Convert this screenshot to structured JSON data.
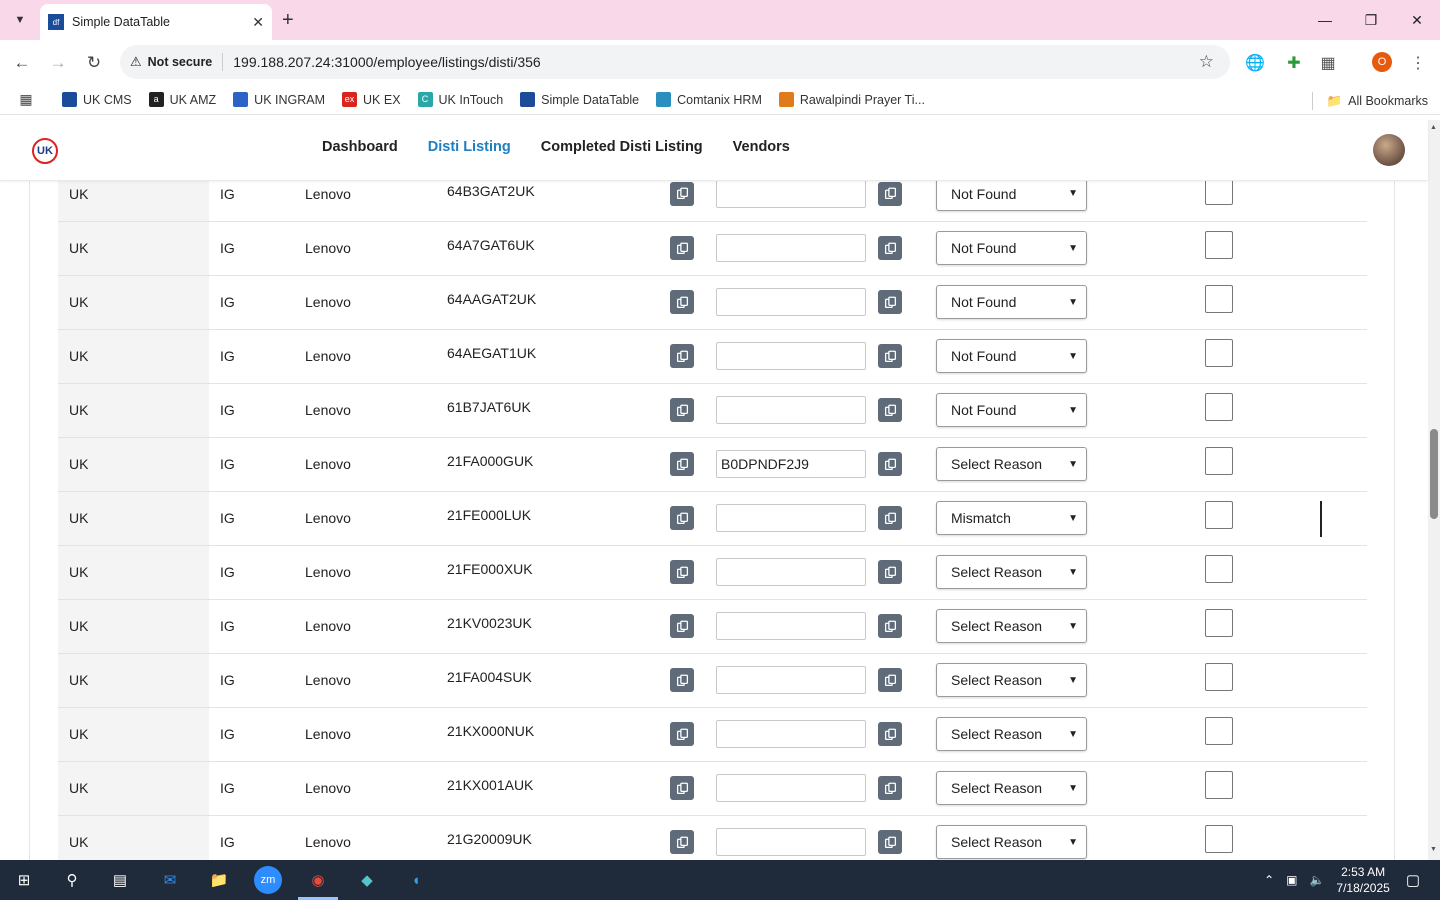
{
  "browser": {
    "tab_title": "Simple DataTable",
    "tab_favicon": "df",
    "new_tab": "+",
    "security_label": "Not secure",
    "url": "199.188.207.24:31000/employee/listings/disti/356",
    "profile_initial": "O",
    "all_bookmarks": "All Bookmarks",
    "bookmarks": [
      {
        "label": "UK CMS",
        "color": "#1a4c9a",
        "glyph": ""
      },
      {
        "label": "UK AMZ",
        "color": "#222222",
        "glyph": "a"
      },
      {
        "label": "UK INGRAM",
        "color": "#2b63c7",
        "glyph": ""
      },
      {
        "label": "UK EX",
        "color": "#d9251d",
        "glyph": "ex"
      },
      {
        "label": "UK InTouch",
        "color": "#2aa8a8",
        "glyph": "C"
      },
      {
        "label": "Simple DataTable",
        "color": "#1a4c9a",
        "glyph": ""
      },
      {
        "label": "Comtanix HRM",
        "color": "#2a8fbf",
        "glyph": ""
      },
      {
        "label": "Rawalpindi Prayer Ti...",
        "color": "#e07b1a",
        "glyph": ""
      }
    ]
  },
  "site": {
    "logo_text": "UK",
    "nav": [
      "Dashboard",
      "Disti Listing",
      "Completed Disti Listing",
      "Vendors"
    ],
    "active_nav": "Disti Listing"
  },
  "rows": [
    {
      "region": "UK",
      "source": "IG",
      "brand": "Lenovo",
      "sku": "64B3GAT2UK",
      "asin": "",
      "reason": "Not Found"
    },
    {
      "region": "UK",
      "source": "IG",
      "brand": "Lenovo",
      "sku": "64A7GAT6UK",
      "asin": "",
      "reason": "Not Found"
    },
    {
      "region": "UK",
      "source": "IG",
      "brand": "Lenovo",
      "sku": "64AAGAT2UK",
      "asin": "",
      "reason": "Not Found"
    },
    {
      "region": "UK",
      "source": "IG",
      "brand": "Lenovo",
      "sku": "64AEGAT1UK",
      "asin": "",
      "reason": "Not Found"
    },
    {
      "region": "UK",
      "source": "IG",
      "brand": "Lenovo",
      "sku": "61B7JAT6UK",
      "asin": "",
      "reason": "Not Found"
    },
    {
      "region": "UK",
      "source": "IG",
      "brand": "Lenovo",
      "sku": "21FA000GUK",
      "asin": "B0DPNDF2J9",
      "reason": "Select Reason"
    },
    {
      "region": "UK",
      "source": "IG",
      "brand": "Lenovo",
      "sku": "21FE000LUK",
      "asin": "",
      "reason": "Mismatch"
    },
    {
      "region": "UK",
      "source": "IG",
      "brand": "Lenovo",
      "sku": "21FE000XUK",
      "asin": "",
      "reason": "Select Reason"
    },
    {
      "region": "UK",
      "source": "IG",
      "brand": "Lenovo",
      "sku": "21KV0023UK",
      "asin": "",
      "reason": "Select Reason"
    },
    {
      "region": "UK",
      "source": "IG",
      "brand": "Lenovo",
      "sku": "21FA004SUK",
      "asin": "",
      "reason": "Select Reason"
    },
    {
      "region": "UK",
      "source": "IG",
      "brand": "Lenovo",
      "sku": "21KX000NUK",
      "asin": "",
      "reason": "Select Reason"
    },
    {
      "region": "UK",
      "source": "IG",
      "brand": "Lenovo",
      "sku": "21KX001AUK",
      "asin": "",
      "reason": "Select Reason"
    },
    {
      "region": "UK",
      "source": "IG",
      "brand": "Lenovo",
      "sku": "21G20009UK",
      "asin": "",
      "reason": "Select Reason"
    }
  ],
  "taskbar": {
    "time": "2:53 AM",
    "date": "7/18/2025",
    "apps": [
      "windows-start",
      "search",
      "task-view",
      "outlook",
      "file-explorer",
      "zoom",
      "chrome",
      "app-diamond",
      "edge"
    ]
  },
  "colors": {
    "tabbar": "#f9d9e9",
    "active_nav": "#1f7fc1",
    "icon_button": "#5f6b78",
    "taskbar": "#1f2b3a"
  }
}
